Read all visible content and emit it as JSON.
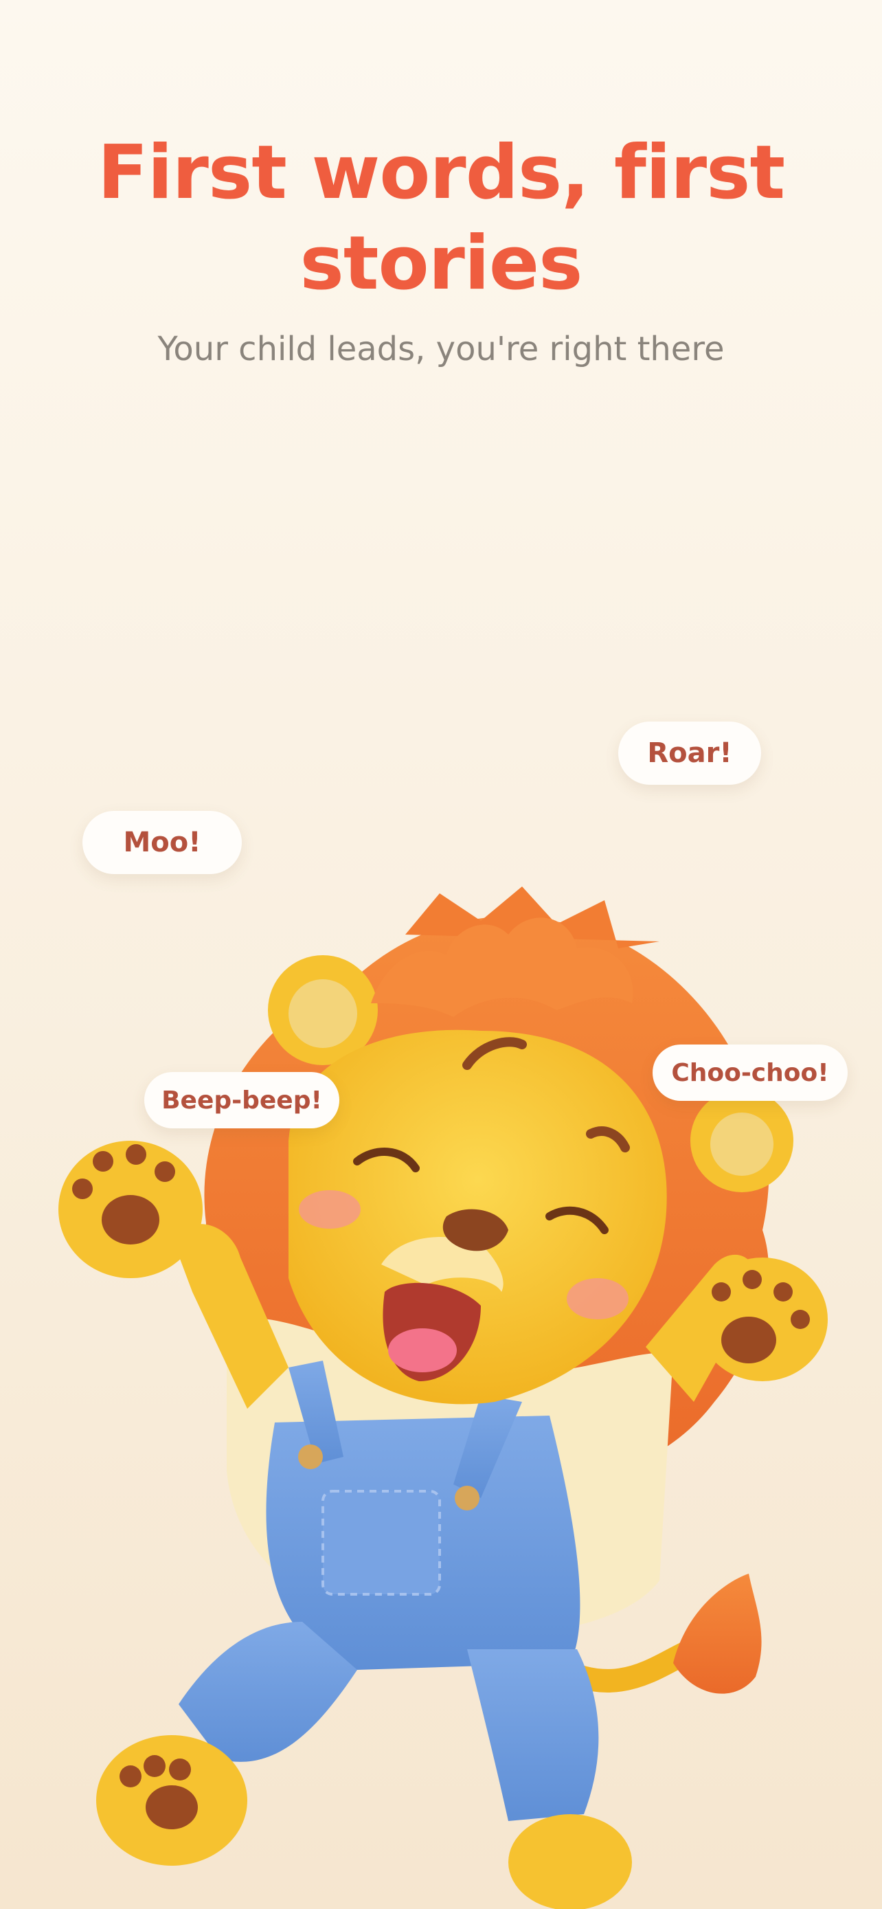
{
  "onboarding": {
    "title": "First words, first stories",
    "subtitle": "Your child leads, you're right there"
  },
  "speech_bubbles": {
    "roar": "Roar!",
    "moo": "Moo!",
    "beep": "Beep-beep!",
    "choo": "Choo-choo!"
  },
  "illustration": {
    "subject": "lion-mascot-icon"
  },
  "colors": {
    "accent": "#ef5d3f",
    "subtitle": "#8a847c",
    "bubble_text": "#b4513d",
    "mane": "#f07a35",
    "fur": "#f6c230",
    "overalls": "#6f9ee0"
  }
}
